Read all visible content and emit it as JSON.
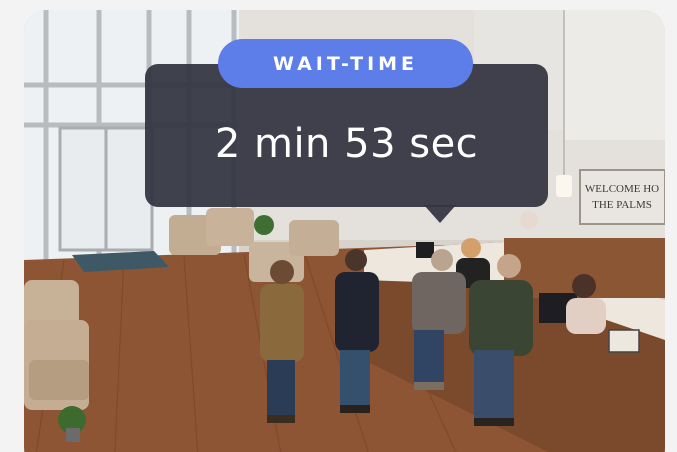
{
  "wait_time": {
    "label": "WAIT-TIME",
    "value": "2 min 53 sec"
  },
  "scene": {
    "sign_line1": "WELCOME HO",
    "sign_line2": "THE PALMS"
  },
  "colors": {
    "pill": "#5d7de8",
    "bubble": "#343542"
  }
}
